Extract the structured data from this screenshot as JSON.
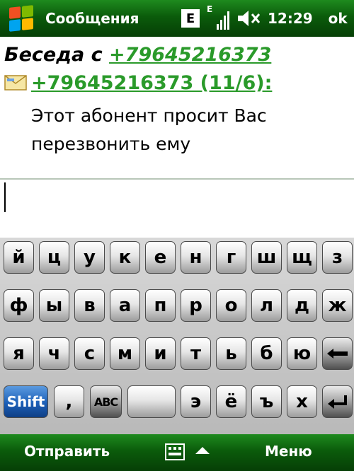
{
  "statusbar": {
    "title": "Сообщения",
    "network_badge": "E",
    "signal_badge": "E",
    "time": "12:29",
    "ok_label": "ok"
  },
  "conversation": {
    "heading_prefix": "Беседа с ",
    "heading_number": "+79645216373",
    "sender_line": "+79645216373 (11/6):",
    "message_line1": "Этот абонент просит Вас",
    "message_line2": "перезвонить ему"
  },
  "keyboard": {
    "row1": [
      "й",
      "ц",
      "у",
      "к",
      "е",
      "н",
      "г",
      "ш",
      "щ",
      "з"
    ],
    "row2": [
      "ф",
      "ы",
      "в",
      "а",
      "п",
      "р",
      "о",
      "л",
      "д",
      "ж"
    ],
    "row3": [
      "я",
      "ч",
      "с",
      "м",
      "и",
      "т",
      "ь",
      "б",
      "ю"
    ],
    "row4": {
      "shift": "Shift",
      "comma": ",",
      "abc": "ABC",
      "space": "",
      "e": "э",
      "yo": "ё",
      "hard": "ъ",
      "h": "х"
    }
  },
  "softkeys": {
    "left": "Отправить",
    "right": "Меню"
  },
  "colors": {
    "bar_green": "#0b5b0b",
    "link_green": "#2a9a2a",
    "shift_blue": "#1c5fb7"
  }
}
